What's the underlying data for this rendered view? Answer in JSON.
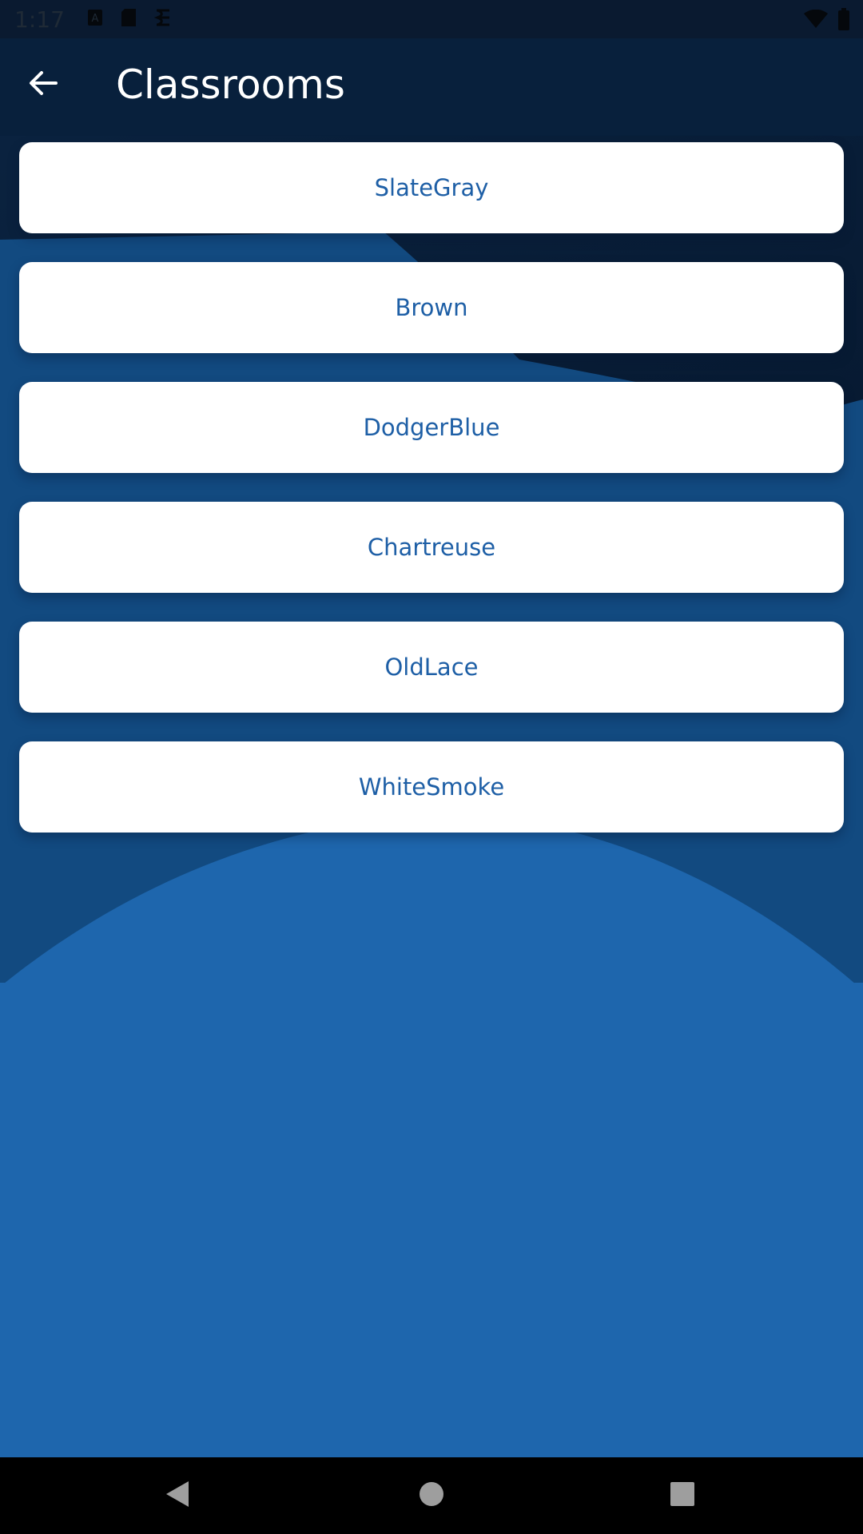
{
  "status_bar": {
    "time": "1:17",
    "icons_left": [
      "a-notification-icon",
      "sd-card-icon",
      "sync-icon"
    ],
    "icons_right": [
      "wifi-icon",
      "battery-icon"
    ]
  },
  "app_bar": {
    "title": "Classrooms",
    "back_icon": "arrow-left-icon"
  },
  "classrooms": [
    {
      "label": "SlateGray"
    },
    {
      "label": "Brown"
    },
    {
      "label": "DodgerBlue"
    },
    {
      "label": "Chartreuse"
    },
    {
      "label": "OldLace"
    },
    {
      "label": "WhiteSmoke"
    }
  ],
  "nav_bar": {
    "icons": [
      "back-triangle-icon",
      "home-circle-icon",
      "recents-square-icon"
    ]
  },
  "colors": {
    "background_dark": "#0a1a30",
    "background_mid": "#124a80",
    "background_light": "#1e66ad",
    "card": "#ffffff",
    "card_text": "#1e5fa6",
    "title_text": "#ffffff"
  }
}
